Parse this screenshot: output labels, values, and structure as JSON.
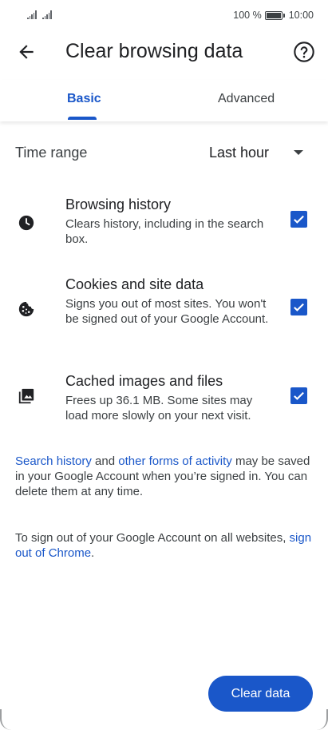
{
  "status_bar": {
    "battery_text": "100 %",
    "time": "10:00",
    "icons": [
      "signal-icon",
      "signal-icon",
      "battery-icon"
    ]
  },
  "app_bar": {
    "title": "Clear browsing data",
    "back_icon": "arrow-back-icon",
    "help_icon": "help-circle-icon"
  },
  "tabs": [
    {
      "label": "Basic",
      "selected": true
    },
    {
      "label": "Advanced",
      "selected": false
    }
  ],
  "time_range": {
    "label": "Time range",
    "value": "Last hour",
    "icon": "dropdown-arrow-icon"
  },
  "options": [
    {
      "icon": "clock-icon",
      "title": "Browsing history",
      "description": "Clears history, including in the search box.",
      "checked": true
    },
    {
      "icon": "cookie-icon",
      "title": "Cookies and site data",
      "description": "Signs you out of most sites. You won't be signed out of your Google Account.",
      "checked": true
    },
    {
      "icon": "image-icon",
      "title": "Cached images and files",
      "description": "Frees up 36.1 MB. Some sites may load more slowly on your next visit.",
      "checked": true
    }
  ],
  "info1": {
    "link1": "Search history",
    "text1": " and ",
    "link2": "other forms of activity",
    "text2": " may be saved in your Google Account when you’re signed in. You can delete them at any time."
  },
  "info2": {
    "text": "To sign out of your Google Account on all websites, ",
    "link": "sign out of Chrome",
    "end": "."
  },
  "clear_button": "Clear data",
  "colors": {
    "accent": "#1a57c9",
    "text_primary": "#202124",
    "text_secondary": "#3c4043"
  }
}
